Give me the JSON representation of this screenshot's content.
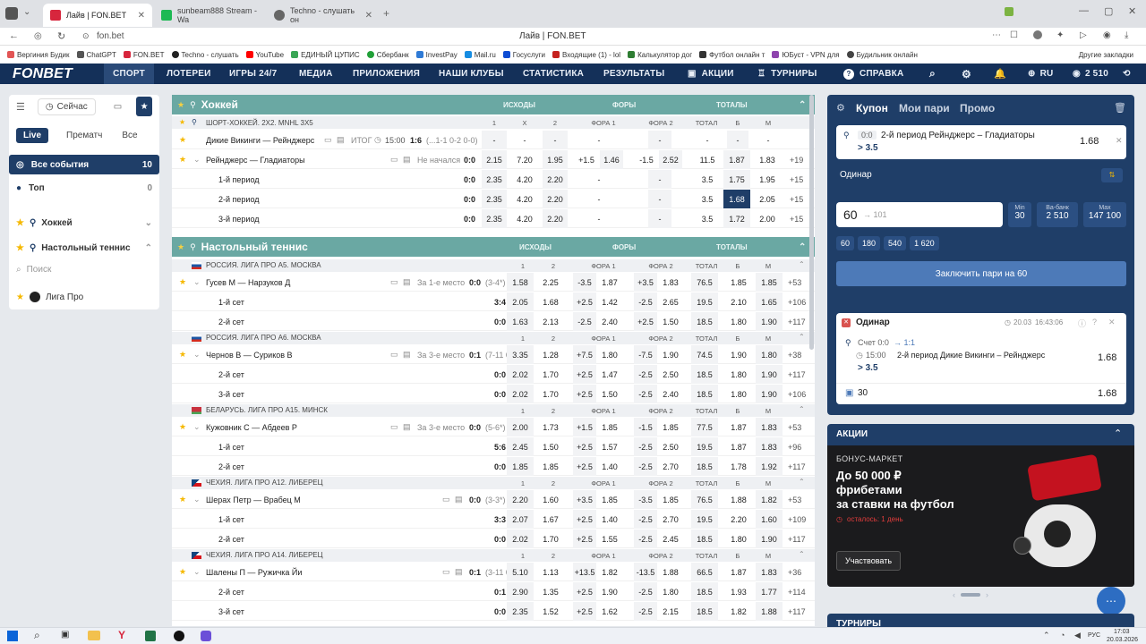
{
  "browser": {
    "tabs": [
      {
        "title": "Лайв | FON.BET",
        "color": "#d7263d"
      },
      {
        "title": "sunbeam888 Stream - Wa",
        "color": "#1db954"
      },
      {
        "title": "Techno - слушать он",
        "color": "#666666"
      }
    ],
    "address": "fon.bet",
    "page_title": "Лайв | FON.BET",
    "bookmarks": [
      "Вергиния Будик",
      "ChatGPT",
      "FON.BET",
      "Techno - слушать",
      "YouTube",
      "ЕДИНЫЙ ЦУПИС",
      "Сбербанк",
      "InvestPay",
      "Mail.ru",
      "Госуслуги",
      "Входящие (1) - lol",
      "Калькулятор дог",
      "Футбол онлайн т",
      "ЮБуст - VPN для",
      "Будильник онлайн"
    ],
    "other_bookmarks": "Другие закладки"
  },
  "site": {
    "logo": "FONBET",
    "nav": [
      "СПОРТ",
      "ЛОТЕРЕИ",
      "ИГРЫ 24/7",
      "МЕДИА",
      "ПРИЛОЖЕНИЯ",
      "НАШИ КЛУБЫ",
      "СТАТИСТИКА",
      "РЕЗУЛЬТАТЫ",
      "АКЦИИ",
      "ТУРНИРЫ",
      "СПРАВКА"
    ],
    "lang": "RU",
    "balance": "2 510"
  },
  "sidebar": {
    "now_label": "Сейчас",
    "filters": [
      "Live",
      "Прематч",
      "Все"
    ],
    "all_events": "Все события",
    "all_events_count": "10",
    "top": "Топ",
    "top_count": "0",
    "sports": [
      "Хоккей",
      "Настольный теннис"
    ],
    "search_placeholder": "Поиск",
    "league": "Лига Про"
  },
  "center": {
    "hockey": {
      "title": "Хоккей",
      "cols": [
        "ИСХОДЫ",
        "ФОРЫ",
        "ТОТАЛЫ"
      ],
      "league": "ШОРТ-ХОККЕЙ. 2Х2. MNHL 3X5",
      "headers": [
        "1",
        "X",
        "2",
        "ФОРА 1",
        "ФОРА 2",
        "ТОТАЛ",
        "Б",
        "М"
      ],
      "rows": [
        {
          "name": "Дикие Викинги — Рейнджерс",
          "status": "ИТОГ",
          "time": "15:00",
          "score": "1:6",
          "extra": "(...1-1 0-2 0-0)",
          "odds": [
            "-",
            "-",
            "-",
            "-",
            "-",
            "-",
            "-",
            "-"
          ],
          "more": ""
        },
        {
          "name": "Рейнджерс — Гладиаторы",
          "status": "Не начался",
          "score": "0:0",
          "odds": [
            "2.15",
            "7.20",
            "1.95",
            "+1.5",
            "1.46",
            "-1.5",
            "2.52",
            "11.5",
            "1.87",
            "1.83"
          ],
          "more": "+19"
        },
        {
          "name": "1-й период",
          "score": "0:0",
          "odds": [
            "2.35",
            "4.20",
            "2.20",
            "-",
            "-",
            "3.5",
            "1.75",
            "1.95"
          ],
          "more": "+15"
        },
        {
          "name": "2-й период",
          "score": "0:0",
          "odds": [
            "2.35",
            "4.20",
            "2.20",
            "-",
            "-",
            "3.5",
            "1.68",
            "2.05"
          ],
          "more": "+15"
        },
        {
          "name": "3-й период",
          "score": "0:0",
          "odds": [
            "2.35",
            "4.20",
            "2.20",
            "-",
            "-",
            "3.5",
            "1.72",
            "2.00"
          ],
          "more": "+15"
        }
      ]
    },
    "tt": {
      "title": "Настольный теннис",
      "cols": [
        "ИСХОДЫ",
        "ФОРЫ",
        "ТОТАЛЫ"
      ],
      "headers": [
        "1",
        "2",
        "ФОРА 1",
        "ФОРА 2",
        "ТОТАЛ",
        "Б",
        "М"
      ],
      "leagues": [
        {
          "name": "РОССИЯ. ЛИГА ПРО А5. МОСКВА",
          "flag": "ru",
          "rows": [
            {
              "name": "Гусев М — Нарзуков Д",
              "status": "За 1-е место",
              "score": "0:0",
              "extra": "(3-4*)",
              "odds": [
                "1.58",
                "2.25",
                "-3.5",
                "1.87",
                "+3.5",
                "1.83",
                "76.5",
                "1.85",
                "1.85"
              ],
              "more": "+53"
            },
            {
              "name": "1-й сет",
              "score": "3:4",
              "odds": [
                "2.05",
                "1.68",
                "+2.5",
                "1.42",
                "-2.5",
                "2.65",
                "19.5",
                "2.10",
                "1.65"
              ],
              "more": "+106"
            },
            {
              "name": "2-й сет",
              "score": "0:0",
              "odds": [
                "1.63",
                "2.13",
                "-2.5",
                "2.40",
                "+2.5",
                "1.50",
                "18.5",
                "1.80",
                "1.90"
              ],
              "more": "+117"
            }
          ]
        },
        {
          "name": "РОССИЯ. ЛИГА ПРО А6. МОСКВА",
          "flag": "ru",
          "rows": [
            {
              "name": "Чернов В — Суриков В",
              "status": "За 3-е место",
              "score": "0:1",
              "extra": "(7-11 0*-0)",
              "odds": [
                "3.35",
                "1.28",
                "+7.5",
                "1.80",
                "-7.5",
                "1.90",
                "74.5",
                "1.90",
                "1.80"
              ],
              "more": "+38"
            },
            {
              "name": "2-й сет",
              "score": "0:0",
              "odds": [
                "2.02",
                "1.70",
                "+2.5",
                "1.47",
                "-2.5",
                "2.50",
                "18.5",
                "1.80",
                "1.90"
              ],
              "more": "+117"
            },
            {
              "name": "3-й сет",
              "score": "0:0",
              "odds": [
                "2.02",
                "1.70",
                "+2.5",
                "1.50",
                "-2.5",
                "2.40",
                "18.5",
                "1.80",
                "1.90"
              ],
              "more": "+106"
            }
          ]
        },
        {
          "name": "БЕЛАРУСЬ. ЛИГА ПРО А15. МИНСК",
          "flag": "by",
          "rows": [
            {
              "name": "Кужовник С — Абдеев Р",
              "status": "За 3-е место",
              "score": "0:0",
              "extra": "(5-6*)",
              "odds": [
                "2.00",
                "1.73",
                "+1.5",
                "1.85",
                "-1.5",
                "1.85",
                "77.5",
                "1.87",
                "1.83"
              ],
              "more": "+53"
            },
            {
              "name": "1-й сет",
              "score": "5:6",
              "odds": [
                "2.45",
                "1.50",
                "+2.5",
                "1.57",
                "-2.5",
                "2.50",
                "19.5",
                "1.87",
                "1.83"
              ],
              "more": "+96"
            },
            {
              "name": "2-й сет",
              "score": "0:0",
              "odds": [
                "1.85",
                "1.85",
                "+2.5",
                "1.40",
                "-2.5",
                "2.70",
                "18.5",
                "1.78",
                "1.92"
              ],
              "more": "+117"
            }
          ]
        },
        {
          "name": "ЧЕХИЯ. ЛИГА ПРО А12. ЛИБЕРЕЦ",
          "flag": "cz",
          "rows": [
            {
              "name": "Шерах Петр — Врабец М",
              "status": "",
              "score": "0:0",
              "extra": "(3-3*)",
              "odds": [
                "2.20",
                "1.60",
                "+3.5",
                "1.85",
                "-3.5",
                "1.85",
                "76.5",
                "1.88",
                "1.82"
              ],
              "more": "+53"
            },
            {
              "name": "1-й сет",
              "score": "3:3",
              "odds": [
                "2.07",
                "1.67",
                "+2.5",
                "1.40",
                "-2.5",
                "2.70",
                "19.5",
                "2.20",
                "1.60"
              ],
              "more": "+109"
            },
            {
              "name": "2-й сет",
              "score": "0:0",
              "odds": [
                "2.02",
                "1.70",
                "+2.5",
                "1.55",
                "-2.5",
                "2.45",
                "18.5",
                "1.80",
                "1.90"
              ],
              "more": "+117"
            }
          ]
        },
        {
          "name": "ЧЕХИЯ. ЛИГА ПРО А14. ЛИБЕРЕЦ",
          "flag": "cz",
          "rows": [
            {
              "name": "Шалены П — Ружичка Йи",
              "status": "",
              "score": "0:1",
              "extra": "(3-11 0-1*)",
              "odds": [
                "5.10",
                "1.13",
                "+13.5",
                "1.82",
                "-13.5",
                "1.88",
                "66.5",
                "1.87",
                "1.83"
              ],
              "more": "+36"
            },
            {
              "name": "2-й сет",
              "score": "0:1",
              "odds": [
                "2.90",
                "1.35",
                "+2.5",
                "1.90",
                "-2.5",
                "1.80",
                "18.5",
                "1.93",
                "1.77"
              ],
              "more": "+114"
            },
            {
              "name": "3-й сет",
              "score": "0:0",
              "odds": [
                "2.35",
                "1.52",
                "+2.5",
                "1.62",
                "-2.5",
                "2.15",
                "18.5",
                "1.82",
                "1.88"
              ],
              "more": "+117"
            }
          ]
        }
      ]
    }
  },
  "coupon": {
    "tabs": [
      "Купон",
      "Мои пари",
      "Промо"
    ],
    "bet_score": "0:0",
    "bet_event": "2-й период Рейнджерс – Гладиаторы",
    "bet_outcome": "> 3.5",
    "bet_odds": "1.68",
    "mode": "Одинар",
    "stake": "60",
    "payout": "→ 101",
    "min_label": "Min",
    "min_value": "30",
    "bank_label": "Ва-банк",
    "bank_value": "2 510",
    "max_label": "Max",
    "max_value": "147 100",
    "quick": [
      "60",
      "180",
      "540",
      "1 620"
    ],
    "submit": "Заключить пари на 60",
    "hist_title": "Одинар",
    "hist_date": "20.03",
    "hist_time": "16:43:06",
    "hist_score_label": "Счет 0:0",
    "hist_score_arrow": "→ 1:1",
    "hist_event_time": "15:00",
    "hist_event": "2-й период Дикие Викинги – Рейнджерс",
    "hist_outcome": "> 3.5",
    "hist_odds": "1.68",
    "hist_stake": "30",
    "hist_total": "1.68"
  },
  "promo": {
    "header": "АКЦИИ",
    "tag": "БОНУС-МАРКЕТ",
    "line1": "До 50 000 ₽",
    "line2": "фрибетами",
    "line3": "за ставки на футбол",
    "left": "осталось: 1 день",
    "button": "Участвовать"
  },
  "tournaments_header": "ТУРНИРЫ",
  "taskbar": {
    "lang": "РУС",
    "time": "17:03",
    "date": "20.03.2026"
  }
}
